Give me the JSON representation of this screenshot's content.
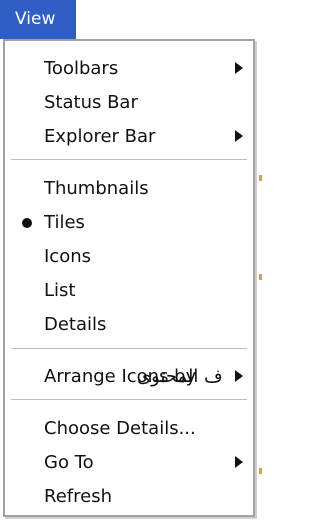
{
  "menubar": {
    "title": "View"
  },
  "menu": {
    "items": [
      {
        "label": "Toolbars",
        "submenu": true
      },
      {
        "label": "Status Bar"
      },
      {
        "label": "Explorer Bar",
        "submenu": true
      },
      {
        "label": "Thumbnails"
      },
      {
        "label": "Tiles",
        "selected": true
      },
      {
        "label": "Icons"
      },
      {
        "label": "List"
      },
      {
        "label": "Details"
      },
      {
        "label": "Arrange Icons by",
        "submenu": true
      },
      {
        "label": "Choose Details..."
      },
      {
        "label": "Go To",
        "submenu": true
      },
      {
        "label": "Refresh"
      }
    ],
    "overlay_text": "ف المحتوى"
  },
  "colors": {
    "accent": "#2f5fc4",
    "menu_border": "#9da1a8",
    "separator": "#bdbdbd"
  },
  "icons": {
    "submenu": "submenu-arrow-icon",
    "selected": "radio-bullet-icon"
  }
}
